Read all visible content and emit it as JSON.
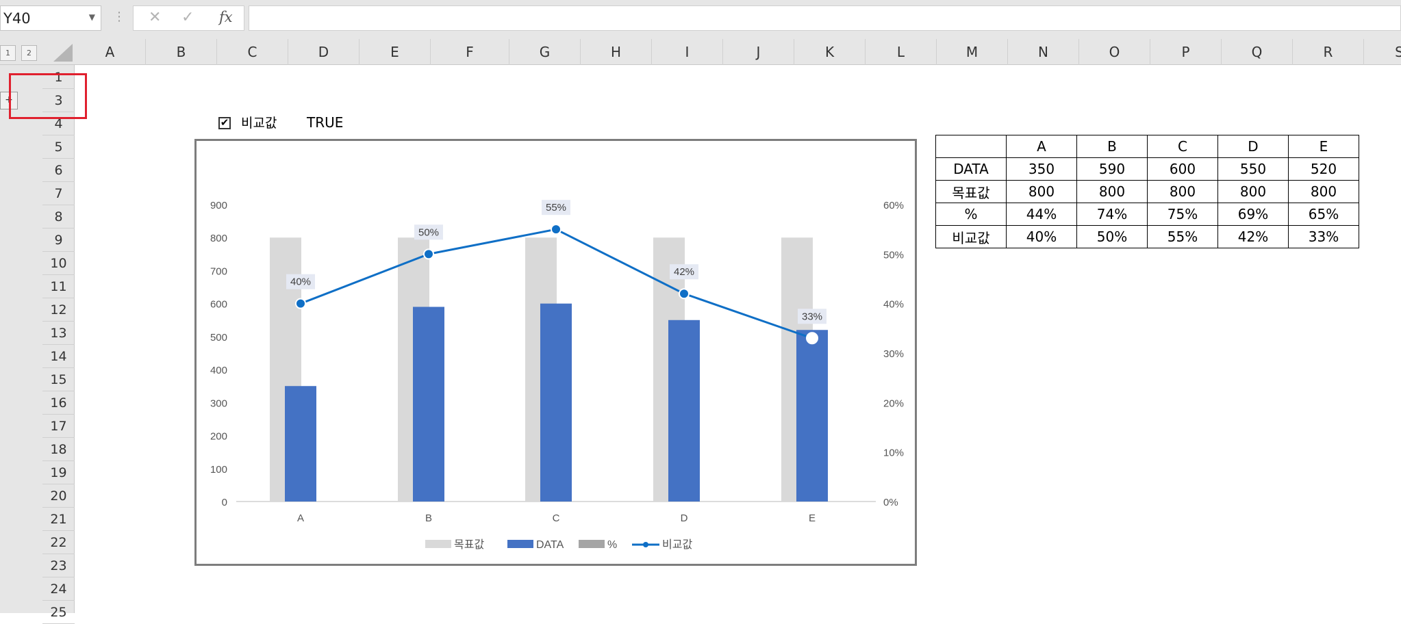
{
  "formula_bar": {
    "name_box": "Y40",
    "cancel_icon": "✕",
    "enter_icon": "✓",
    "fx_label": "fx",
    "formula": ""
  },
  "outline": {
    "levels": [
      "1",
      "2"
    ],
    "expand_symbol": "+"
  },
  "columns": [
    "A",
    "B",
    "C",
    "D",
    "E",
    "F",
    "G",
    "H",
    "I",
    "J",
    "K",
    "L",
    "M",
    "N",
    "O",
    "P",
    "Q",
    "R",
    "S"
  ],
  "rows": [
    "1",
    "3",
    "4",
    "5",
    "6",
    "7",
    "8",
    "9",
    "10",
    "11",
    "12",
    "13",
    "14",
    "15",
    "16",
    "17",
    "18",
    "19",
    "20",
    "21",
    "22",
    "23",
    "24",
    "25"
  ],
  "checkbox": {
    "checked": true,
    "mark": "✔",
    "label": "비교값",
    "linked_value": "TRUE"
  },
  "chart_data": {
    "type": "bar",
    "categories": [
      "A",
      "B",
      "C",
      "D",
      "E"
    ],
    "series": [
      {
        "name": "목표값",
        "type": "bar",
        "axis": "left",
        "color": "#d9d9d9",
        "values": [
          800,
          800,
          800,
          800,
          800
        ]
      },
      {
        "name": "DATA",
        "type": "bar",
        "axis": "left",
        "color": "#4472c4",
        "values": [
          350,
          590,
          600,
          550,
          520
        ]
      },
      {
        "name": "%",
        "type": "bar",
        "axis": "right",
        "color": "#a5a5a5",
        "values": []
      },
      {
        "name": "비교값",
        "type": "line",
        "axis": "right",
        "color": "#0f6fc6",
        "values": [
          0.4,
          0.5,
          0.55,
          0.42,
          0.33
        ],
        "labels": [
          "40%",
          "50%",
          "55%",
          "42%",
          "33%"
        ]
      }
    ],
    "ylim": [
      0,
      900
    ],
    "yticks": [
      "0",
      "100",
      "200",
      "300",
      "400",
      "500",
      "600",
      "700",
      "800",
      "900"
    ],
    "y2lim": [
      0,
      0.6
    ],
    "y2ticks": [
      "0%",
      "10%",
      "20%",
      "30%",
      "40%",
      "50%",
      "60%"
    ],
    "legend_position": "bottom",
    "grid": false
  },
  "table": {
    "header": [
      "",
      "A",
      "B",
      "C",
      "D",
      "E"
    ],
    "rows": [
      [
        "DATA",
        "350",
        "590",
        "600",
        "550",
        "520"
      ],
      [
        "목표값",
        "800",
        "800",
        "800",
        "800",
        "800"
      ],
      [
        "%",
        "44%",
        "74%",
        "75%",
        "69%",
        "65%"
      ],
      [
        "비교값",
        "40%",
        "50%",
        "55%",
        "42%",
        "33%"
      ]
    ]
  },
  "colors": {
    "chrome_gray": "#e6e6e6",
    "highlight_red": "#e0202e",
    "target_bar": "#d9d9d9",
    "data_bar": "#4472c4",
    "percent_bar": "#a5a5a5",
    "compare_line": "#0f6fc6"
  }
}
